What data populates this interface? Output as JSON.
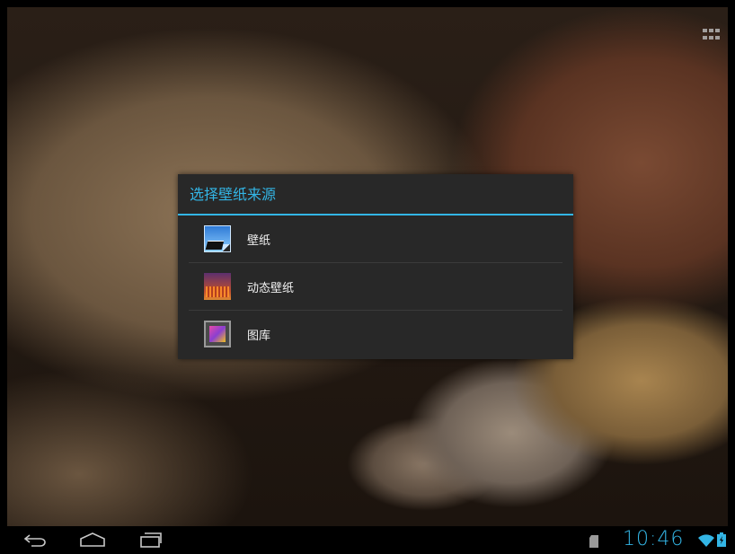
{
  "dialog": {
    "title": "选择壁纸来源",
    "items": [
      {
        "label": "壁纸",
        "icon": "wallpaper-icon"
      },
      {
        "label": "动态壁纸",
        "icon": "live-wallpaper-icon"
      },
      {
        "label": "图库",
        "icon": "gallery-icon"
      }
    ]
  },
  "status_bar": {
    "time": "10:46",
    "icons": [
      "sd-card-icon",
      "wifi-icon",
      "battery-icon"
    ]
  },
  "navigation": {
    "buttons": [
      "back-icon",
      "home-icon",
      "recent-apps-icon"
    ]
  },
  "colors": {
    "accent": "#33b5e5",
    "dialog_bg": "#282828",
    "nav_bg": "#000000"
  }
}
